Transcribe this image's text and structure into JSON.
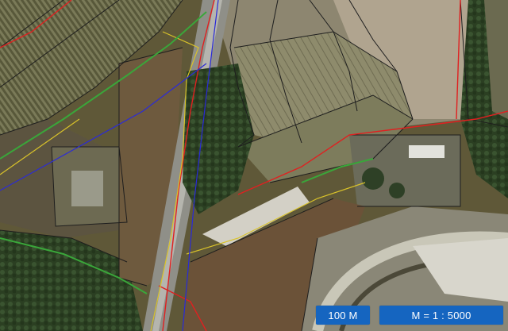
{
  "map": {
    "view": "satellite-cadastral",
    "colors": {
      "fields_dark": "#5f5838",
      "fields_light": "#9b9a7c",
      "vegetation": "#2f4424",
      "road": "#8f8f88",
      "parcel_lines": "#222222",
      "boundary_red": "#e02020",
      "boundary_yellow": "#d8c22a",
      "boundary_blue": "#2a2ad8",
      "boundary_green": "#3aa63a",
      "label_bg": "#1565c0",
      "label_text": "#ffffff"
    }
  },
  "scale": {
    "bar_label": "100 M",
    "ratio_label": "M = 1 : 5000"
  }
}
